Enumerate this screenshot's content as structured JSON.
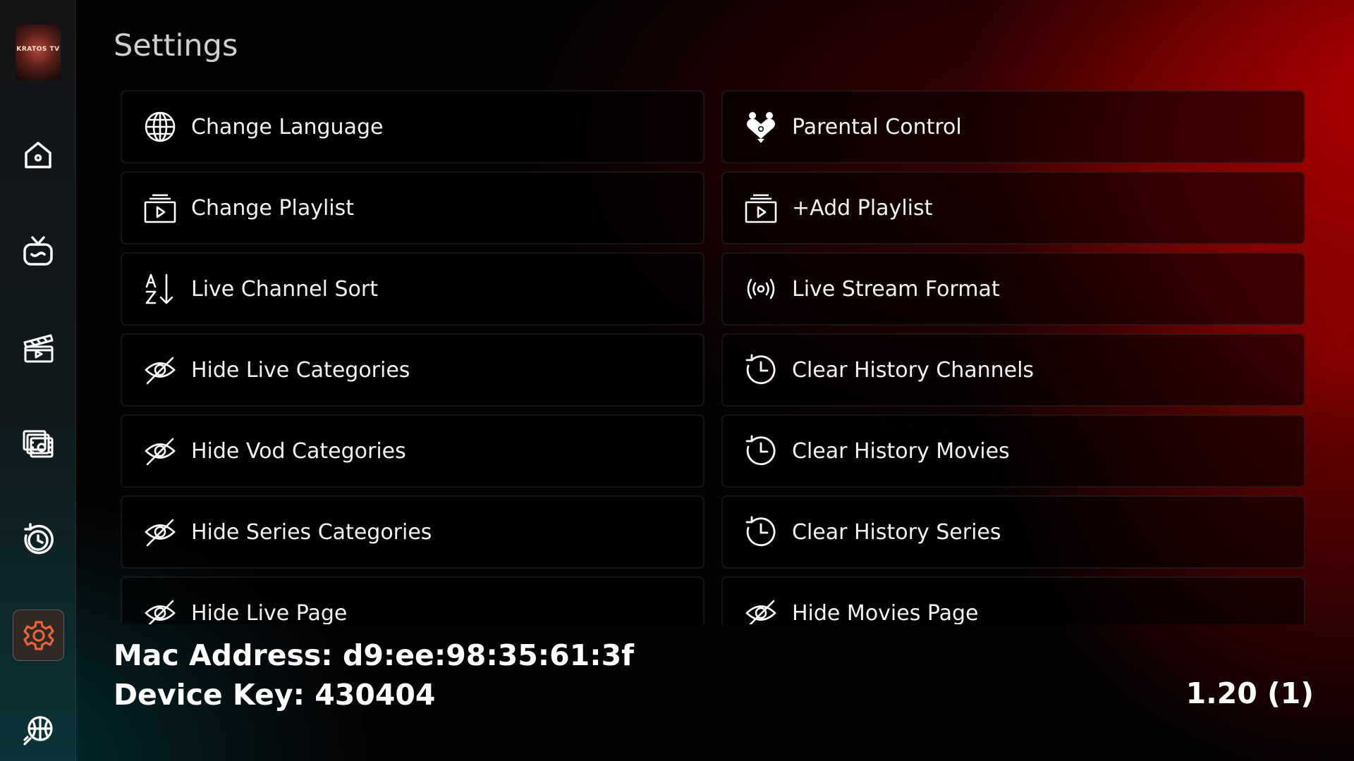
{
  "page": {
    "title": "Settings"
  },
  "sidebar": {
    "logo_text": "KRATOS TV",
    "items": [
      {
        "name": "home-icon",
        "active": false
      },
      {
        "name": "live-tv-icon",
        "active": false
      },
      {
        "name": "movies-icon",
        "active": false
      },
      {
        "name": "series-icon",
        "active": false
      },
      {
        "name": "catchup-icon",
        "active": false
      },
      {
        "name": "settings-icon",
        "active": true
      },
      {
        "name": "sports-icon",
        "active": false
      }
    ]
  },
  "settings": {
    "left": [
      {
        "label": "Change Language",
        "icon": "globe-icon"
      },
      {
        "label": "Change Playlist",
        "icon": "playlist-icon"
      },
      {
        "label": "Live Channel Sort",
        "icon": "sort-az-icon"
      },
      {
        "label": "Hide Live Categories",
        "icon": "eye-off-icon"
      },
      {
        "label": "Hide Vod Categories",
        "icon": "eye-off-icon"
      },
      {
        "label": "Hide Series Categories",
        "icon": "eye-off-icon"
      },
      {
        "label": "Hide Live Page",
        "icon": "eye-off-icon"
      }
    ],
    "right": [
      {
        "label": "Parental Control",
        "icon": "family-icon"
      },
      {
        "label": "+Add Playlist",
        "icon": "playlist-icon"
      },
      {
        "label": "Live Stream Format",
        "icon": "broadcast-icon"
      },
      {
        "label": "Clear History Channels",
        "icon": "history-icon"
      },
      {
        "label": "Clear History Movies",
        "icon": "history-icon"
      },
      {
        "label": "Clear History Series",
        "icon": "history-icon"
      },
      {
        "label": "Hide Movies Page",
        "icon": "eye-off-icon"
      }
    ]
  },
  "device": {
    "mac": "Mac Address: d9:ee:98:35:61:3f",
    "key": "Device Key: 430404",
    "version": "1.20 (1)"
  },
  "colors": {
    "accent": "#c0392b",
    "active_icon": "#e8643c"
  }
}
